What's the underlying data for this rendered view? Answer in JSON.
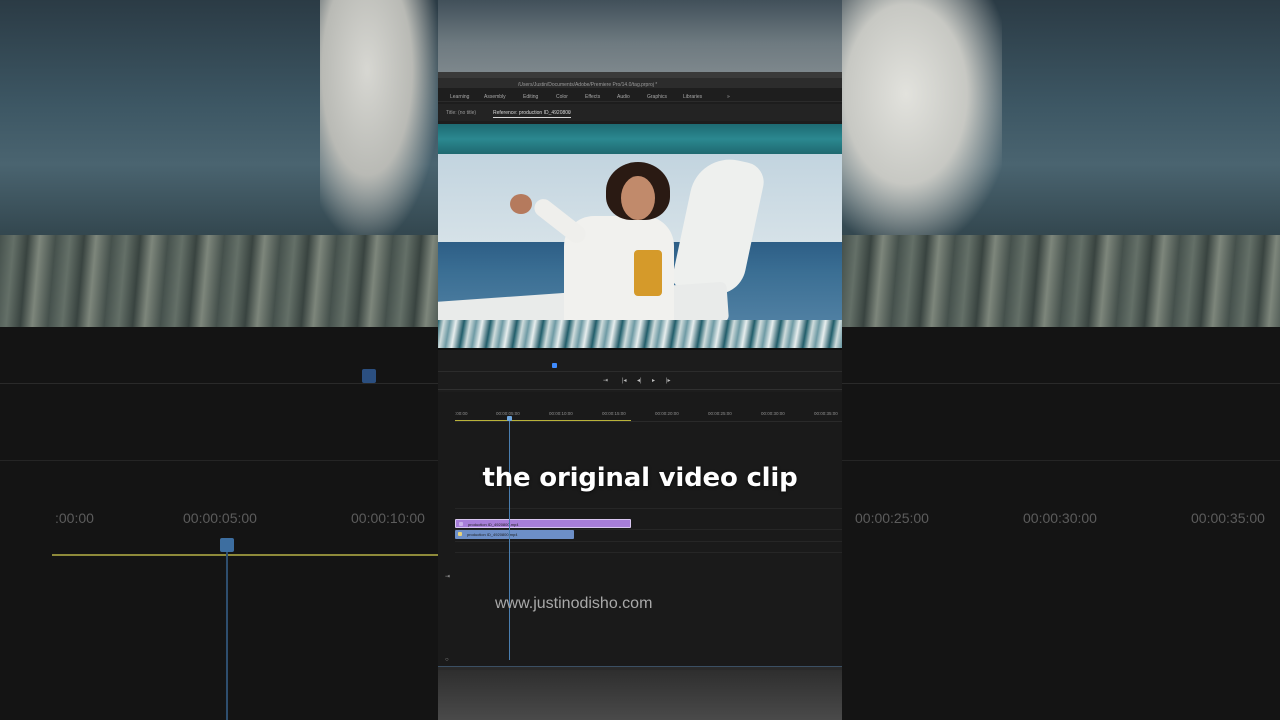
{
  "app": {
    "project_path": "/Users/Justin/Documents/Adobe/Premiere Pro/14.0/tag.prproj *"
  },
  "workspaces": [
    "Learning",
    "Assembly",
    "Editing",
    "Color",
    "Effects",
    "Audio",
    "Graphics",
    "Libraries",
    "»"
  ],
  "monitor": {
    "title_tab": "Title: (no title)",
    "reference_tab": "Reference: production ID_4920800"
  },
  "transport": {
    "buttons": [
      "⇥",
      "|◂",
      "◂|",
      "▸",
      "|▸",
      "▸|"
    ]
  },
  "timeline": {
    "ruler_labels": [
      ":00:00",
      "00:00:05:00",
      "00:00:10:00",
      "00:00:15:00",
      "00:00:20:00",
      "00:00:25:00",
      "00:00:30:00",
      "00:00:35:00"
    ],
    "video_clip_name": "production ID_4920800.mp4",
    "audio_clip_name": "production ID_4920800.mp4"
  },
  "background_ruler": {
    "left_labels": [
      ":00:00",
      "00:00:05:00",
      "00:00:10:00"
    ],
    "right_labels": [
      "00:00:25:00",
      "00:00:30:00",
      "00:00:35:00"
    ]
  },
  "overlay": {
    "caption": "the original video clip",
    "watermark": "www.justinodisho.com"
  }
}
